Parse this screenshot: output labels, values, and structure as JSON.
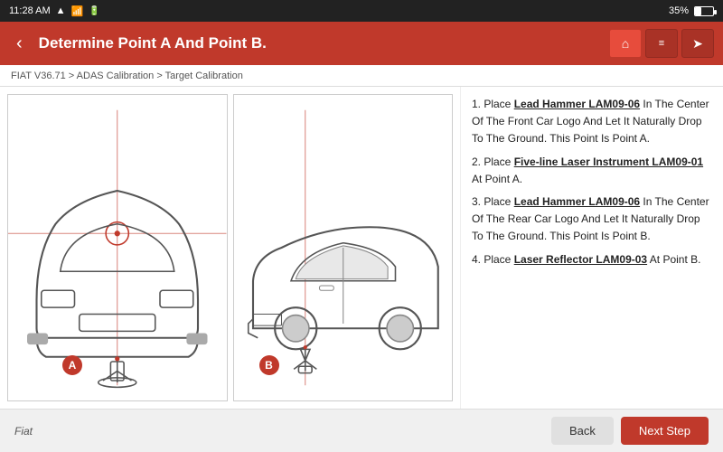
{
  "statusBar": {
    "time": "11:28 AM",
    "battery": "35%"
  },
  "header": {
    "backLabel": "‹",
    "title": "Determine Point A And Point B.",
    "icons": {
      "home": "⌂",
      "doc": "≡",
      "export": "➤"
    }
  },
  "breadcrumb": {
    "path": "FIAT V36.71 > ADAS Calibration > Target Calibration"
  },
  "instructions": {
    "step1": "1. Place ",
    "step1_tool": "Lead Hammer LAM09-06",
    "step1_rest": " In The Center Of The Front Car Logo And Let It Naturally Drop To The Ground. This Point Is Point A.",
    "step2": "2. Place ",
    "step2_tool": "Five-line Laser Instrument LAM09-01",
    "step2_rest": " At Point A.",
    "step3": "3. Place ",
    "step3_tool": "Lead Hammer LAM09-06",
    "step3_rest": " In The Center Of The Rear Car Logo And Let It Naturally Drop To The Ground. This Point Is Point B.",
    "step4": "4. Place ",
    "step4_tool": "Laser Reflector LAM09-03",
    "step4_rest": " At Point B."
  },
  "pointLabels": {
    "a": "A",
    "b": "B"
  },
  "footer": {
    "brand": "Fiat",
    "backBtn": "Back",
    "nextBtn": "Next Step"
  }
}
